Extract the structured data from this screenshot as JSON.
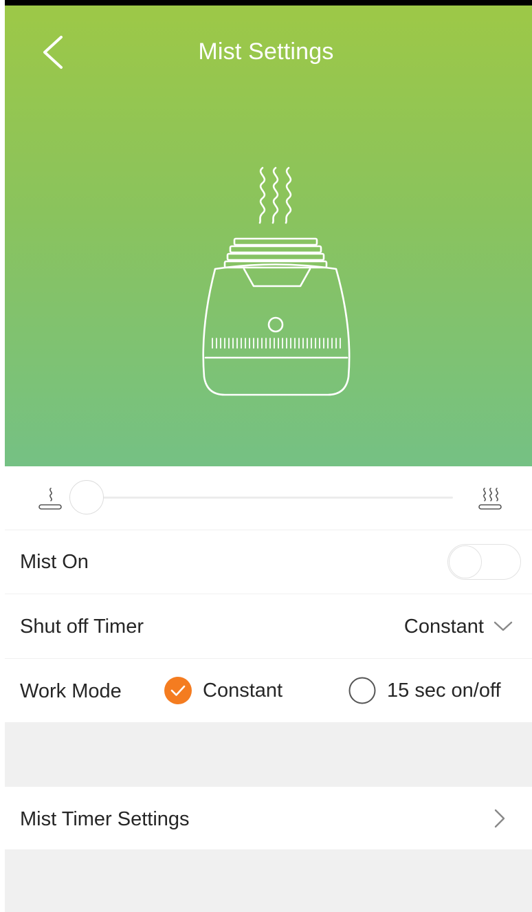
{
  "header": {
    "title": "Mist Settings"
  },
  "mist_level": {
    "value": 0,
    "low_icon": "single-mist-icon",
    "high_icon": "triple-mist-icon"
  },
  "mist_on": {
    "label": "Mist On",
    "enabled": false
  },
  "shut_off_timer": {
    "label": "Shut off Timer",
    "value": "Constant"
  },
  "work_mode": {
    "label": "Work Mode",
    "options": [
      {
        "label": "Constant",
        "selected": true
      },
      {
        "label": "15 sec on/off",
        "selected": false
      }
    ]
  },
  "mist_timer_settings": {
    "label": "Mist Timer Settings"
  },
  "colors": {
    "gradient_top": "#9dc847",
    "gradient_bottom": "#75c184",
    "accent": "#f47c20"
  }
}
